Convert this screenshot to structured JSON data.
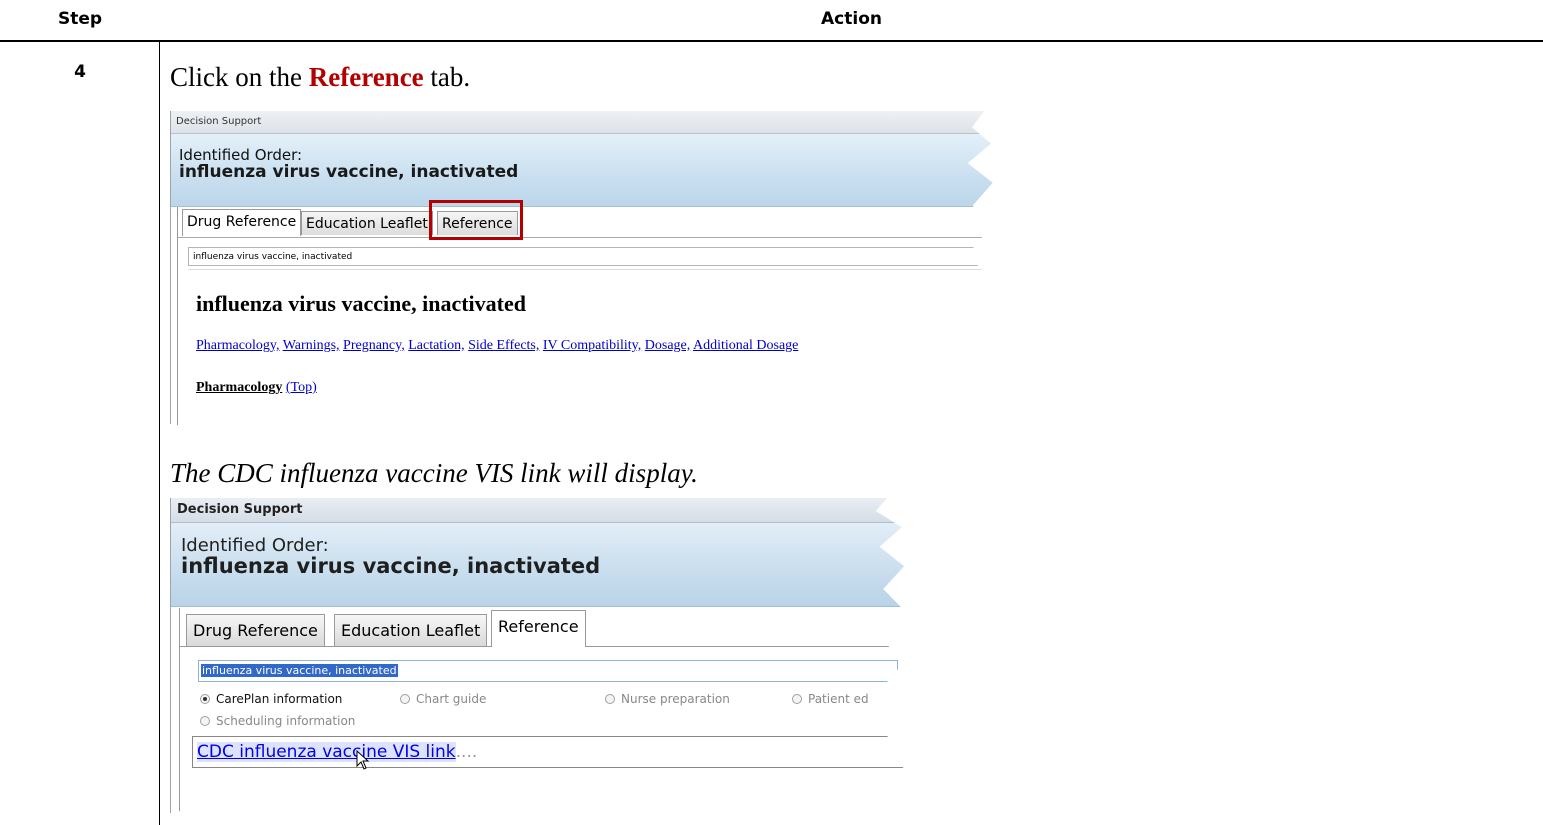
{
  "header": {
    "step_label": "Step",
    "action_label": "Action"
  },
  "step": {
    "number": "4",
    "instruction_pre": "Click on the ",
    "instruction_emph": "Reference",
    "instruction_post": " tab.",
    "result_note": "The CDC influenza vaccine VIS link will display."
  },
  "screenshot1": {
    "title": "Decision Support",
    "identified_label": "Identified Order:",
    "order_name": "influenza virus vaccine, inactivated",
    "tabs": [
      "Drug Reference",
      "Education Leaflet",
      "Reference"
    ],
    "field_value": "influenza virus vaccine, inactivated",
    "heading": "influenza virus vaccine, inactivated",
    "links": [
      "Pharmacology,",
      "Warnings,",
      "Pregnancy,",
      "Lactation,",
      "Side Effects,",
      "IV Compatibility,",
      "Dosage,",
      "Additional Dosage"
    ],
    "section_label": "Pharmacology",
    "top_link": "(Top)",
    "highlight_color": "#b40000"
  },
  "screenshot2": {
    "title": "Decision Support",
    "identified_label": "Identified Order:",
    "order_name": "influenza virus vaccine, inactivated",
    "tabs": [
      "Drug Reference",
      "Education Leaflet",
      "Reference"
    ],
    "field_value": "influenza virus vaccine, inactivated",
    "radios": [
      "CarePlan information",
      "Chart guide",
      "Nurse preparation",
      "Patient ed",
      "Scheduling information"
    ],
    "selected_radio": "CarePlan information",
    "link_text": "CDC influenza vaccine VIS link",
    "link_suffix": "...."
  }
}
